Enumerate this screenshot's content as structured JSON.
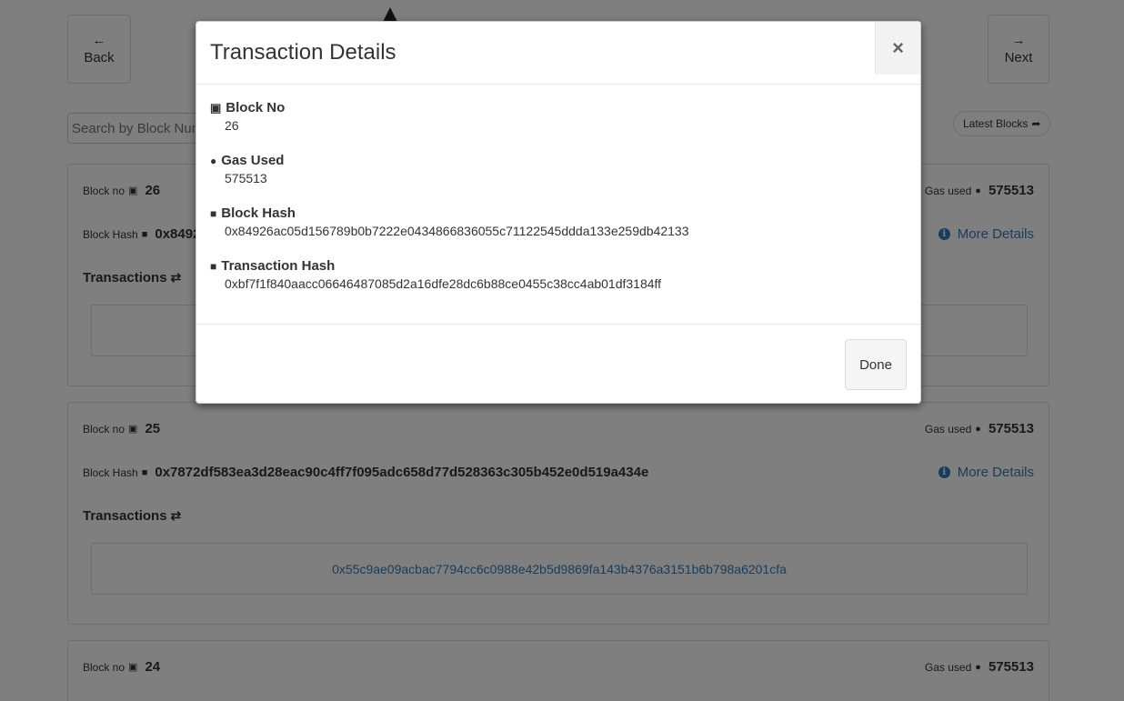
{
  "nav": {
    "back_arrow": "🡐",
    "back_label": "Back",
    "next_arrow": "🡒",
    "next_label": "Next"
  },
  "search": {
    "placeholder": "Search by Block Number"
  },
  "latest_blocks": {
    "label": "Latest Blocks"
  },
  "cards": [
    {
      "block_no_label": "Block no",
      "block_no": "26",
      "gas_label": "Gas used",
      "gas": "575513",
      "hash_label": "Block Hash",
      "hash": "0x84926ac05d156789b0b7222e0434866836055c71122545ddda133e259db42133",
      "more_details": "More Details",
      "transactions_label": "Transactions",
      "tx": ""
    },
    {
      "block_no_label": "Block no",
      "block_no": "25",
      "gas_label": "Gas used",
      "gas": "575513",
      "hash_label": "Block Hash",
      "hash": "0x7872df583ea3d28eac90c4ff7f095adc658d77d528363c305b452e0d519a434e",
      "more_details": "More Details",
      "transactions_label": "Transactions",
      "tx": "0x55c9ae09acbac7794cc6c0988e42b5d9869fa143b4376a3151b6b798a6201cfa"
    },
    {
      "block_no_label": "Block no",
      "block_no": "24",
      "gas_label": "Gas used",
      "gas": "575513"
    }
  ],
  "modal": {
    "title": "Transaction Details",
    "close": "×",
    "fields": [
      {
        "label": "Block No",
        "value": "26",
        "icon": "cube-icon"
      },
      {
        "label": "Gas Used",
        "value": "575513",
        "icon": "fire-icon"
      },
      {
        "label": "Block Hash",
        "value": "0x84926ac05d156789b0b7222e0434866836055c71122545ddda133e259db42133",
        "icon": "lock-icon"
      },
      {
        "label": "Transaction Hash",
        "value": "0xbf7f1f840aacc06646487085d2a16dfe28dc6b88ce0455c38cc4ab01df3184ff",
        "icon": "lock-icon"
      }
    ],
    "done": "Done"
  }
}
